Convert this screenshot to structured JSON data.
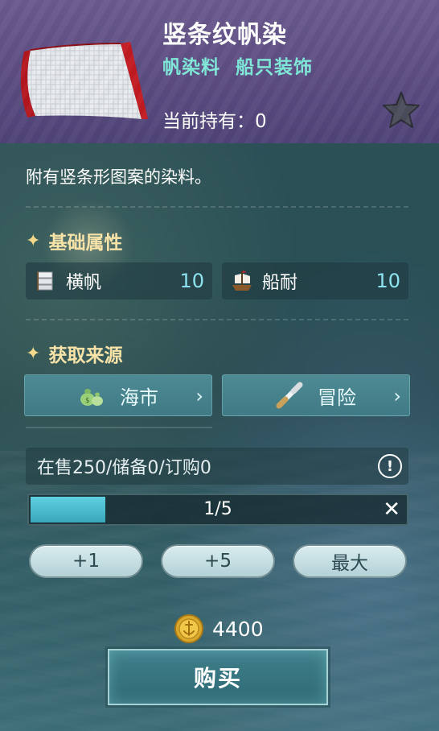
{
  "item": {
    "title": "竖条纹帆染",
    "tags": [
      "帆染料",
      "船只装饰"
    ],
    "holding_label": "当前持有：0",
    "description": "附有竖条形图案的染料。"
  },
  "attributes": {
    "section_title": "基础属性",
    "items": [
      {
        "name": "横帆",
        "value": "10",
        "icon": "sail-icon"
      },
      {
        "name": "船耐",
        "value": "10",
        "icon": "ship-icon"
      }
    ]
  },
  "sources": {
    "section_title": "获取来源",
    "items": [
      {
        "label": "海市",
        "icon": "money-bag-icon"
      },
      {
        "label": "冒险",
        "icon": "spyglass-icon"
      }
    ]
  },
  "market": {
    "stock_text": "在售250/储备0/订购0"
  },
  "quantity": {
    "text": "1/5",
    "fill_fraction": 0.2
  },
  "quick_buttons": [
    "+1",
    "+5",
    "最大"
  ],
  "purchase": {
    "price": "4400",
    "buy_label": "购买"
  },
  "colors": {
    "header_bg": "#5b4b80",
    "accent_teal": "#7ee8d8",
    "value_cyan": "#8fe2ef",
    "section_gold": "#f7e3a8"
  }
}
